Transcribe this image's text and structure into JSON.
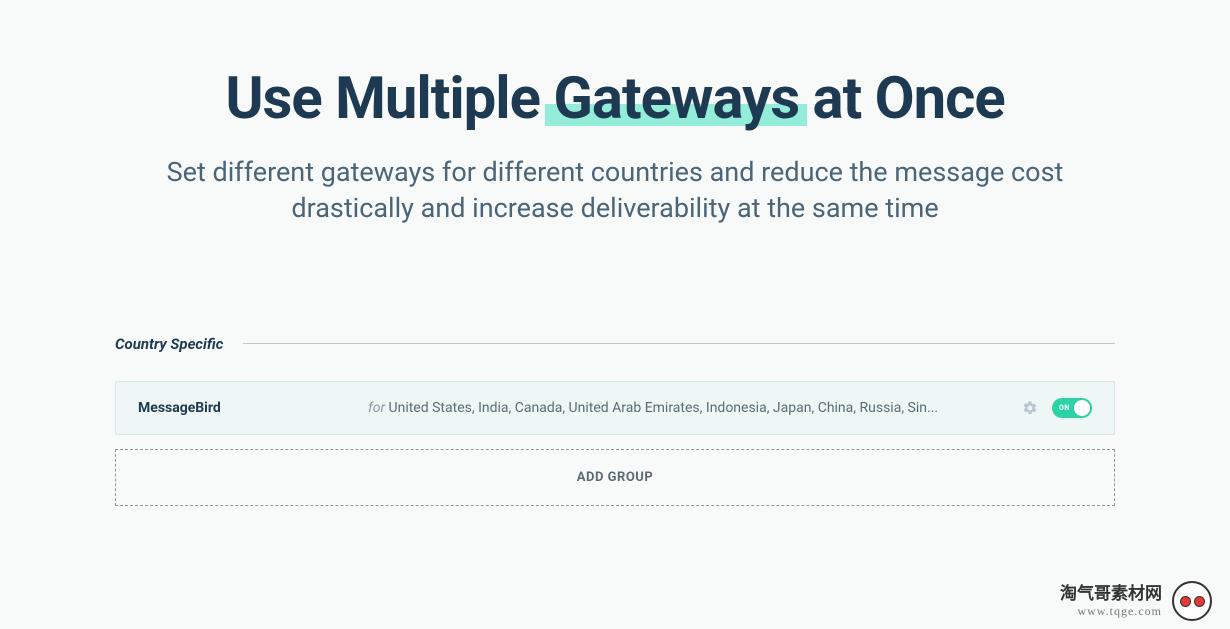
{
  "heading": {
    "part1": "Use Multiple ",
    "highlight": "Gateways",
    "part2": " at Once"
  },
  "subtitle": "Set different gateways for different countries and reduce the message cost drastically and increase deliverability at the same time",
  "section": {
    "title": "Country Specific"
  },
  "gateway": {
    "name": "MessageBird",
    "for_label": "for ",
    "countries": "United States, India, Canada, United Arab Emirates, Indonesia, Japan, China, Russia, Sin...",
    "toggle_label": "ON"
  },
  "add_group_label": "ADD GROUP",
  "watermark": {
    "cn": "淘气哥素材网",
    "url": "www.tqge.com"
  }
}
